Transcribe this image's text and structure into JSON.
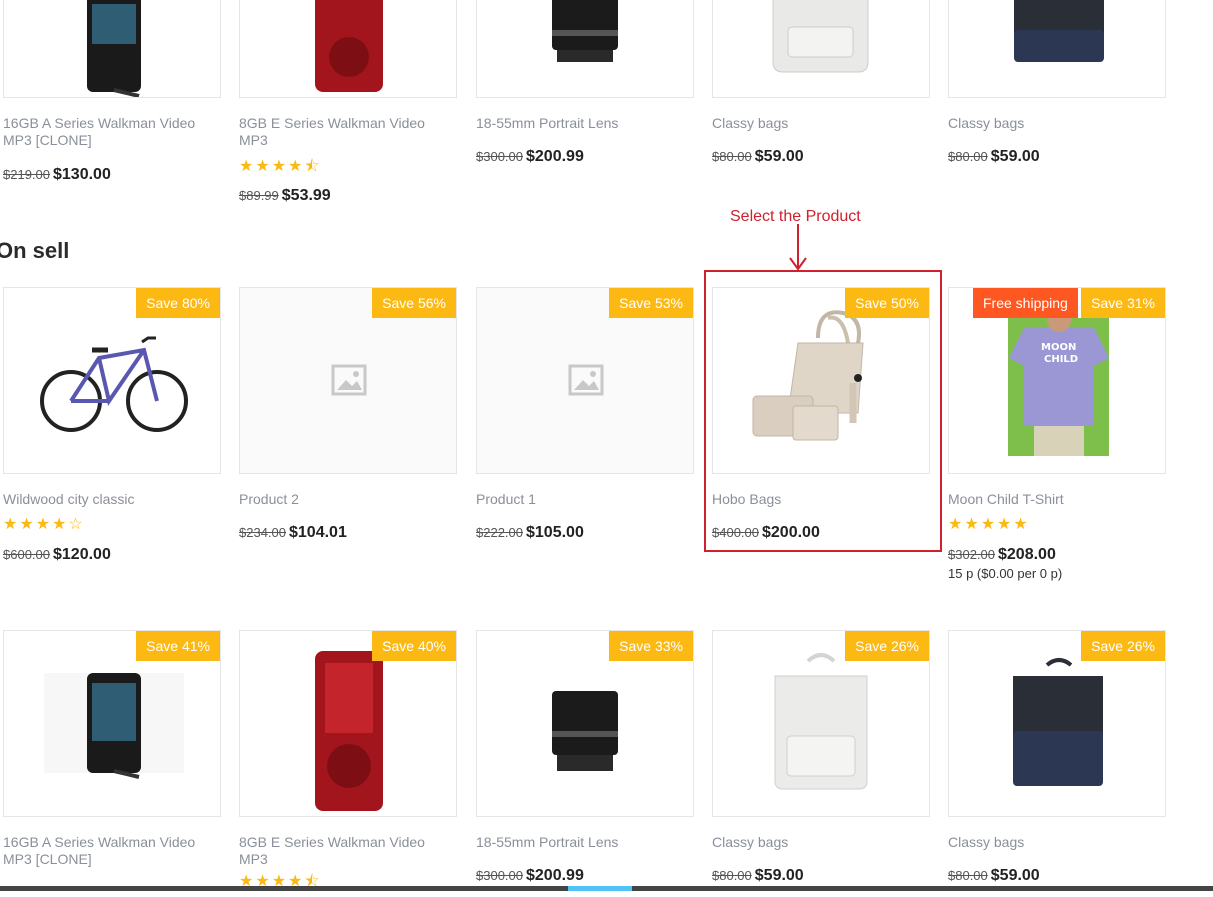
{
  "top_row": [
    {
      "name": "16GB A Series Walkman Video MP3 [CLONE]",
      "old_price": "$219.00",
      "price": "$130.00",
      "stars": "",
      "icon": "walkman-black-icon"
    },
    {
      "name": "8GB E Series Walkman Video MP3",
      "old_price": "$89.99",
      "price": "$53.99",
      "stars": "★★★★⯪",
      "icon": "walkman-red-icon"
    },
    {
      "name": "18-55mm Portrait Lens",
      "old_price": "$300.00",
      "price": "$200.99",
      "stars": "",
      "icon": "camera-lens-icon"
    },
    {
      "name": "Classy bags",
      "old_price": "$80.00",
      "price": "$59.00",
      "stars": "",
      "icon": "white-backpack-icon"
    },
    {
      "name": "Classy bags",
      "old_price": "$80.00",
      "price": "$59.00",
      "stars": "",
      "icon": "black-backpack-icon"
    }
  ],
  "section": {
    "title": "On sell"
  },
  "annotation": {
    "text": "Select the Product",
    "color": "#d0202c"
  },
  "sale_row": [
    {
      "name": "Wildwood city classic",
      "badge": "Save 80%",
      "old_price": "$600.00",
      "price": "$120.00",
      "stars": "★★★★☆",
      "icon": "bicycle-icon"
    },
    {
      "name": "Product 2",
      "badge": "Save 56%",
      "old_price": "$234.00",
      "price": "$104.01",
      "stars": "",
      "icon": "image-placeholder-icon"
    },
    {
      "name": "Product 1",
      "badge": "Save 53%",
      "old_price": "$222.00",
      "price": "$105.00",
      "stars": "",
      "icon": "image-placeholder-icon"
    },
    {
      "name": "Hobo Bags",
      "badge": "Save 50%",
      "old_price": "$400.00",
      "price": "$200.00",
      "stars": "",
      "icon": "handbag-icon"
    },
    {
      "name": "Moon Child T-Shirt",
      "badge": "Save 31%",
      "badge2": "Free shipping",
      "old_price": "$302.00",
      "price": "$208.00",
      "unit": "15 p ($0.00 per 0 p)",
      "stars": "★★★★★",
      "icon": "tshirt-icon"
    }
  ],
  "bottom_row": [
    {
      "name": "16GB A Series Walkman Video MP3 [CLONE]",
      "badge": "Save 41%",
      "icon": "walkman-black-icon"
    },
    {
      "name": "8GB E Series Walkman Video MP3",
      "badge": "Save 40%",
      "stars": "★★★★⯪",
      "icon": "walkman-red-icon"
    },
    {
      "name": "18-55mm Portrait Lens",
      "badge": "Save 33%",
      "old_price": "$300.00",
      "price": "$200.99",
      "icon": "camera-lens-icon"
    },
    {
      "name": "Classy bags",
      "badge": "Save 26%",
      "old_price": "$80.00",
      "price": "$59.00",
      "icon": "white-backpack-icon"
    },
    {
      "name": "Classy bags",
      "badge": "Save 26%",
      "old_price": "$80.00",
      "price": "$59.00",
      "icon": "black-backpack-icon"
    }
  ],
  "colors": {
    "badge": "#fdb913",
    "shipping_badge": "#ff5722",
    "star": "#fdb913",
    "highlight": "#d0202c"
  }
}
